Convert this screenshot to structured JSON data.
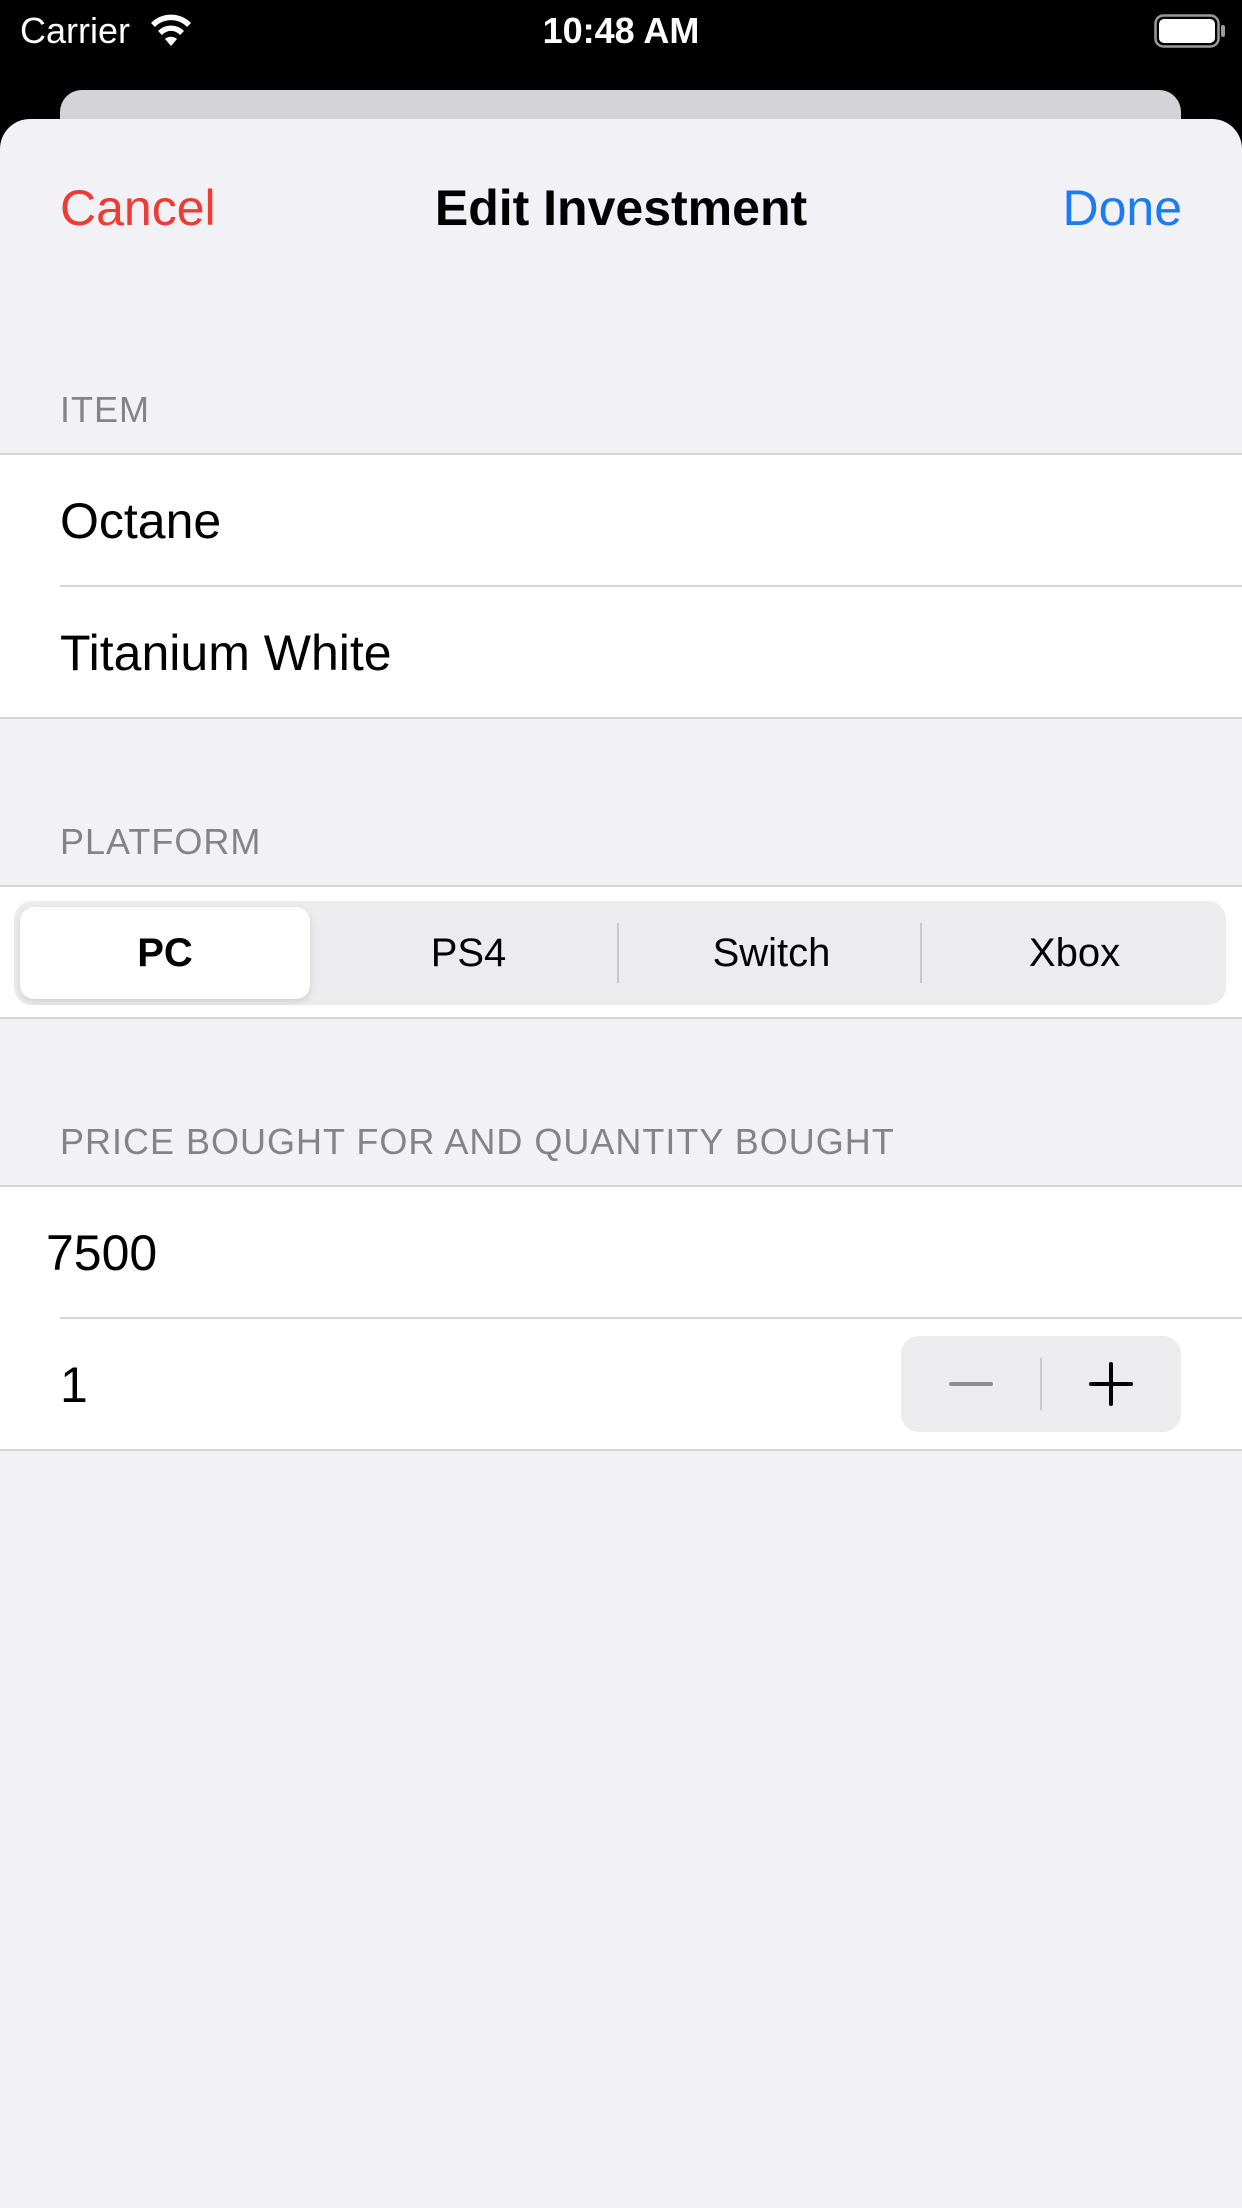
{
  "status_bar": {
    "carrier": "Carrier",
    "time": "10:48 AM"
  },
  "nav": {
    "cancel_label": "Cancel",
    "title": "Edit Investment",
    "done_label": "Done"
  },
  "item_section": {
    "header": "ITEM",
    "name": "Octane",
    "paint": "Titanium White"
  },
  "platform_section": {
    "header": "PLATFORM",
    "options": [
      "PC",
      "PS4",
      "Switch",
      "Xbox"
    ],
    "selected": "PC"
  },
  "price_section": {
    "header": "PRICE BOUGHT FOR AND QUANTITY BOUGHT",
    "price": "7500",
    "quantity": "1"
  },
  "colors": {
    "cancel": "#f03a32",
    "done": "#1a7cf5",
    "background": "#f1f1f6"
  },
  "icons": {
    "wifi": "wifi-icon",
    "battery": "battery-icon",
    "minus": "minus-icon",
    "plus": "plus-icon"
  }
}
